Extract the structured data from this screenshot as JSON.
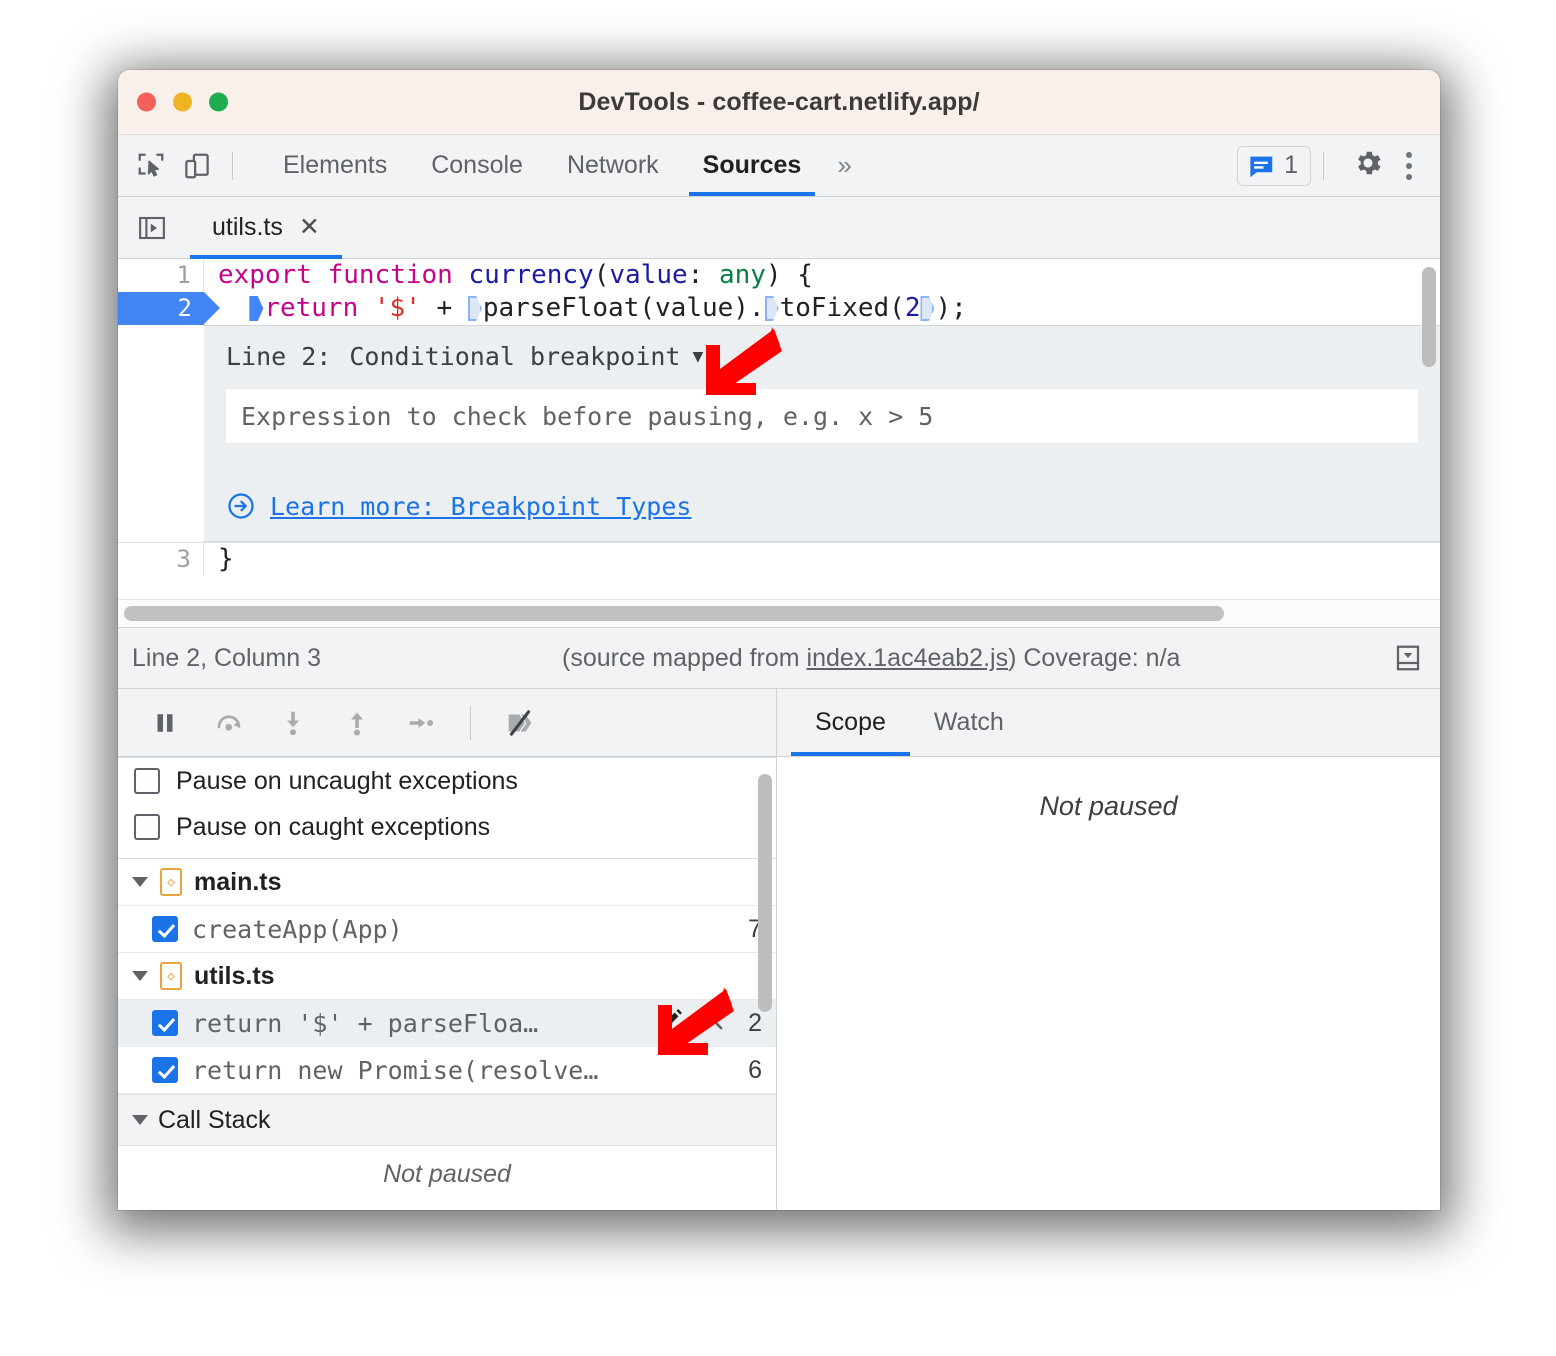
{
  "window": {
    "title": "DevTools - coffee-cart.netlify.app/",
    "traffic_lights": [
      "close",
      "minimize",
      "maximize"
    ],
    "colors": {
      "close": "#f4615b",
      "minimize": "#f0b323",
      "maximize": "#1dac50",
      "titlebar_bg": "#faf0eb"
    }
  },
  "toolbar": {
    "inspect_icon": "inspect-cursor-icon",
    "device_icon": "device-toolbar-icon",
    "tabs": [
      {
        "label": "Elements",
        "active": false
      },
      {
        "label": "Console",
        "active": false
      },
      {
        "label": "Network",
        "active": false
      },
      {
        "label": "Sources",
        "active": true
      }
    ],
    "more_tabs_label": "»",
    "issues": {
      "icon": "message-issues-icon",
      "count": "1"
    },
    "settings_icon": "gear-icon",
    "menu_icon": "kebab-menu-icon",
    "accent_color": "#1a73e8"
  },
  "file_tabs": {
    "panel_toggle_icon": "show-navigator-icon",
    "tabs": [
      {
        "name": "utils.ts",
        "close": "✕",
        "active": true
      }
    ]
  },
  "editor": {
    "lines": [
      {
        "number": "1",
        "breakpoint": false,
        "tokens": [
          {
            "t": "export",
            "c": "k-keyword"
          },
          {
            "t": " ",
            "c": "k-plain"
          },
          {
            "t": "function",
            "c": "k-keyword"
          },
          {
            "t": " ",
            "c": "k-plain"
          },
          {
            "t": "currency",
            "c": "k-func"
          },
          {
            "t": "(",
            "c": "k-plain"
          },
          {
            "t": "value",
            "c": "k-param"
          },
          {
            "t": ": ",
            "c": "k-plain"
          },
          {
            "t": "any",
            "c": "k-type"
          },
          {
            "t": ") {",
            "c": "k-plain"
          }
        ]
      },
      {
        "number": "2",
        "breakpoint": true,
        "text": "  return '$' + parseFloat(value).toFixed(2);"
      },
      {
        "number": "3",
        "breakpoint": false,
        "text": "}"
      }
    ],
    "breakpoint_editor": {
      "line_label": "Line 2:",
      "type_label": "Conditional breakpoint",
      "caret": "▼",
      "input_placeholder": "Expression to check before pausing, e.g. x > 5",
      "input_value": "",
      "learn_more_icon": "arrow-circle-right-icon",
      "learn_more_text": "Learn more: Breakpoint Types"
    }
  },
  "status": {
    "position": "Line 2, Column 3",
    "source_map_prefix": "(source mapped from ",
    "source_map_link": "index.1ac4eab2.js",
    "source_map_suffix": ")",
    "coverage": "Coverage: n/a",
    "drawer_icon": "show-drawer-icon"
  },
  "debugger": {
    "controls": [
      {
        "name": "resume-script-execution",
        "icon": "pause-icon"
      },
      {
        "name": "step-over-next-function-call",
        "icon": "step-over-icon"
      },
      {
        "name": "step-into-next-function-call",
        "icon": "step-into-icon"
      },
      {
        "name": "step-out-of-current-function",
        "icon": "step-out-icon"
      },
      {
        "name": "step",
        "icon": "step-icon"
      },
      {
        "name": "deactivate-breakpoints",
        "icon": "deactivate-breakpoints-icon"
      }
    ],
    "pause_options": [
      {
        "label": "Pause on uncaught exceptions",
        "checked": false
      },
      {
        "label": "Pause on caught exceptions",
        "checked": false
      }
    ],
    "breakpoint_groups": [
      {
        "file": "main.ts",
        "expanded": true,
        "items": [
          {
            "code": "createApp(App)",
            "line": "7",
            "checked": true,
            "selected": false,
            "actions": []
          }
        ]
      },
      {
        "file": "utils.ts",
        "expanded": true,
        "items": [
          {
            "code": "return '$' + parseFloa…",
            "line": "2",
            "checked": true,
            "selected": true,
            "actions": [
              "edit-icon",
              "remove-icon"
            ]
          },
          {
            "code": "return new Promise(resolve…",
            "line": "6",
            "checked": true,
            "selected": false,
            "actions": []
          }
        ]
      }
    ],
    "call_stack": {
      "label": "Call Stack",
      "expanded": true,
      "empty_text": "Not paused"
    }
  },
  "side_panel": {
    "tabs": [
      {
        "label": "Scope",
        "active": true
      },
      {
        "label": "Watch",
        "active": false
      }
    ],
    "empty_text": "Not paused"
  },
  "annotations": [
    {
      "name": "arrow-to-conditional-breakpoint-dropdown",
      "color": "#ff0000"
    },
    {
      "name": "arrow-to-breakpoint-remove-icon",
      "color": "#ff0000"
    }
  ]
}
